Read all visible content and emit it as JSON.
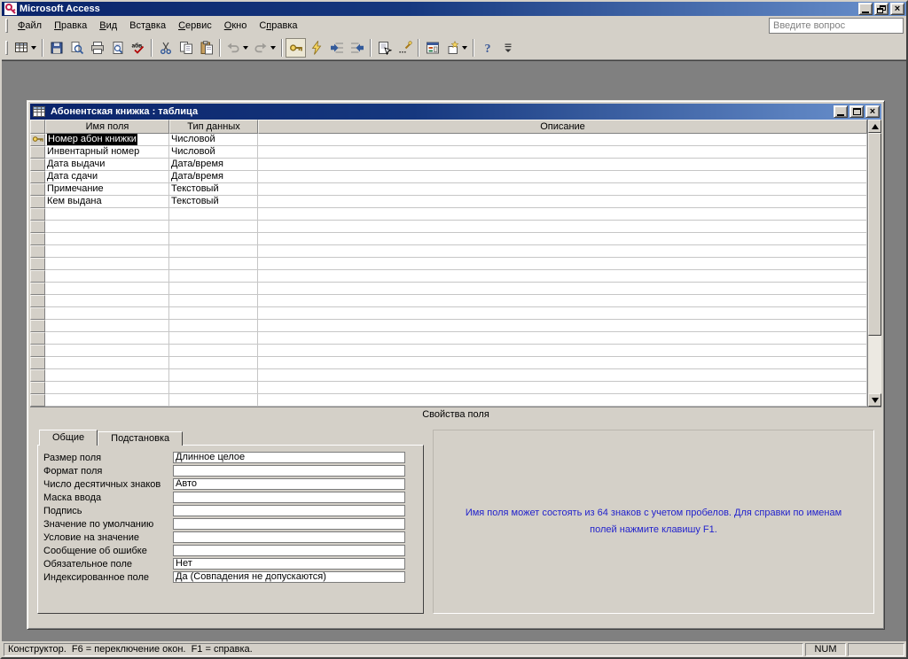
{
  "colors": {
    "titlebar_gradient_start": "#0a246a",
    "titlebar_gradient_end": "#6a91cd",
    "window_face": "#d4d0c8",
    "workspace_background": "#808080",
    "help_text_blue": "#2222cc",
    "selection_background": "#000000",
    "selection_text": "#ffffff"
  },
  "icons": {
    "close": "×"
  },
  "app": {
    "title": "Microsoft Access"
  },
  "menu": {
    "items": [
      {
        "id": "file",
        "label": "Файл",
        "u": 0
      },
      {
        "id": "edit",
        "label": "Правка",
        "u": 0
      },
      {
        "id": "view",
        "label": "Вид",
        "u": 0
      },
      {
        "id": "insert",
        "label": "Вставка",
        "u": 3
      },
      {
        "id": "tools",
        "label": "Сервис",
        "u": 0
      },
      {
        "id": "window",
        "label": "Окно",
        "u": 0
      },
      {
        "id": "help",
        "label": "Справка",
        "u": 1
      }
    ],
    "question_box": "Введите вопрос"
  },
  "toolbar": {
    "buttons": [
      {
        "name": "view-design-button",
        "icon": "table-view-icon",
        "dropdown": true
      },
      {
        "sep": true
      },
      {
        "name": "save-button",
        "icon": "save-icon"
      },
      {
        "name": "search-button",
        "icon": "search-icon"
      },
      {
        "name": "print-button",
        "icon": "print-icon"
      },
      {
        "name": "print-preview-button",
        "icon": "print-preview-icon"
      },
      {
        "name": "spelling-button",
        "icon": "spelling-icon"
      },
      {
        "sep": true
      },
      {
        "name": "cut-button",
        "icon": "cut-icon"
      },
      {
        "name": "copy-button",
        "icon": "copy-icon"
      },
      {
        "name": "paste-button",
        "icon": "paste-icon"
      },
      {
        "sep": true
      },
      {
        "name": "undo-button",
        "icon": "undo-icon",
        "dropdown": true,
        "disabled": true
      },
      {
        "name": "redo-button",
        "icon": "redo-icon",
        "dropdown": true,
        "disabled": true
      },
      {
        "sep": true
      },
      {
        "name": "primary-key-button",
        "icon": "key-icon",
        "pressed": true
      },
      {
        "name": "indexes-button",
        "icon": "indexes-icon"
      },
      {
        "name": "insert-rows-button",
        "icon": "insert-rows-icon"
      },
      {
        "name": "delete-rows-button",
        "icon": "delete-rows-icon"
      },
      {
        "sep": true
      },
      {
        "name": "properties-button",
        "icon": "properties-icon"
      },
      {
        "name": "build-button",
        "icon": "build-icon"
      },
      {
        "sep": true
      },
      {
        "name": "database-window-button",
        "icon": "database-window-icon"
      },
      {
        "name": "new-object-button",
        "icon": "new-object-icon",
        "dropdown": true
      },
      {
        "sep": true
      },
      {
        "name": "help-button",
        "icon": "help-icon"
      },
      {
        "name": "toolbar-options-button",
        "icon": "chevron-down-icon"
      }
    ]
  },
  "document_window": {
    "title": "Абонентская книжка : таблица"
  },
  "design_grid": {
    "columns": [
      "Имя поля",
      "Тип данных",
      "Описание"
    ],
    "rows": [
      {
        "name": "Номер абон книжки",
        "type": "Числовой",
        "description": "",
        "primary_key": true,
        "selected": true
      },
      {
        "name": "Инвентарный номер",
        "type": "Числовой",
        "description": ""
      },
      {
        "name": "Дата выдачи",
        "type": "Дата/время",
        "description": ""
      },
      {
        "name": "Дата сдачи",
        "type": "Дата/время",
        "description": ""
      },
      {
        "name": "Примечание",
        "type": "Текстовый",
        "description": ""
      },
      {
        "name": "Кем выдана",
        "type": "Текстовый",
        "description": ""
      }
    ],
    "empty_row_count": 16,
    "band_label": "Свойства поля"
  },
  "field_properties": {
    "tabs": [
      {
        "label": "Общие",
        "active": true
      },
      {
        "label": "Подстановка",
        "active": false
      }
    ],
    "rows": [
      {
        "label": "Размер поля",
        "value": "Длинное целое"
      },
      {
        "label": "Формат поля",
        "value": ""
      },
      {
        "label": "Число десятичных знаков",
        "value": "Авто"
      },
      {
        "label": "Маска ввода",
        "value": ""
      },
      {
        "label": "Подпись",
        "value": ""
      },
      {
        "label": "Значение по умолчанию",
        "value": ""
      },
      {
        "label": "Условие на значение",
        "value": ""
      },
      {
        "label": "Сообщение об ошибке",
        "value": ""
      },
      {
        "label": "Обязательное поле",
        "value": "Нет"
      },
      {
        "label": "Индексированное поле",
        "value": "Да (Совпадения не допускаются)"
      }
    ],
    "help_text": "Имя поля может состоять из 64 знаков с учетом пробелов.  Для справки по именам полей нажмите клавишу F1."
  },
  "status_bar": {
    "mode_text": "Конструктор.  F6 = переключение окон.  F1 = справка.",
    "num_indicator": "NUM"
  }
}
